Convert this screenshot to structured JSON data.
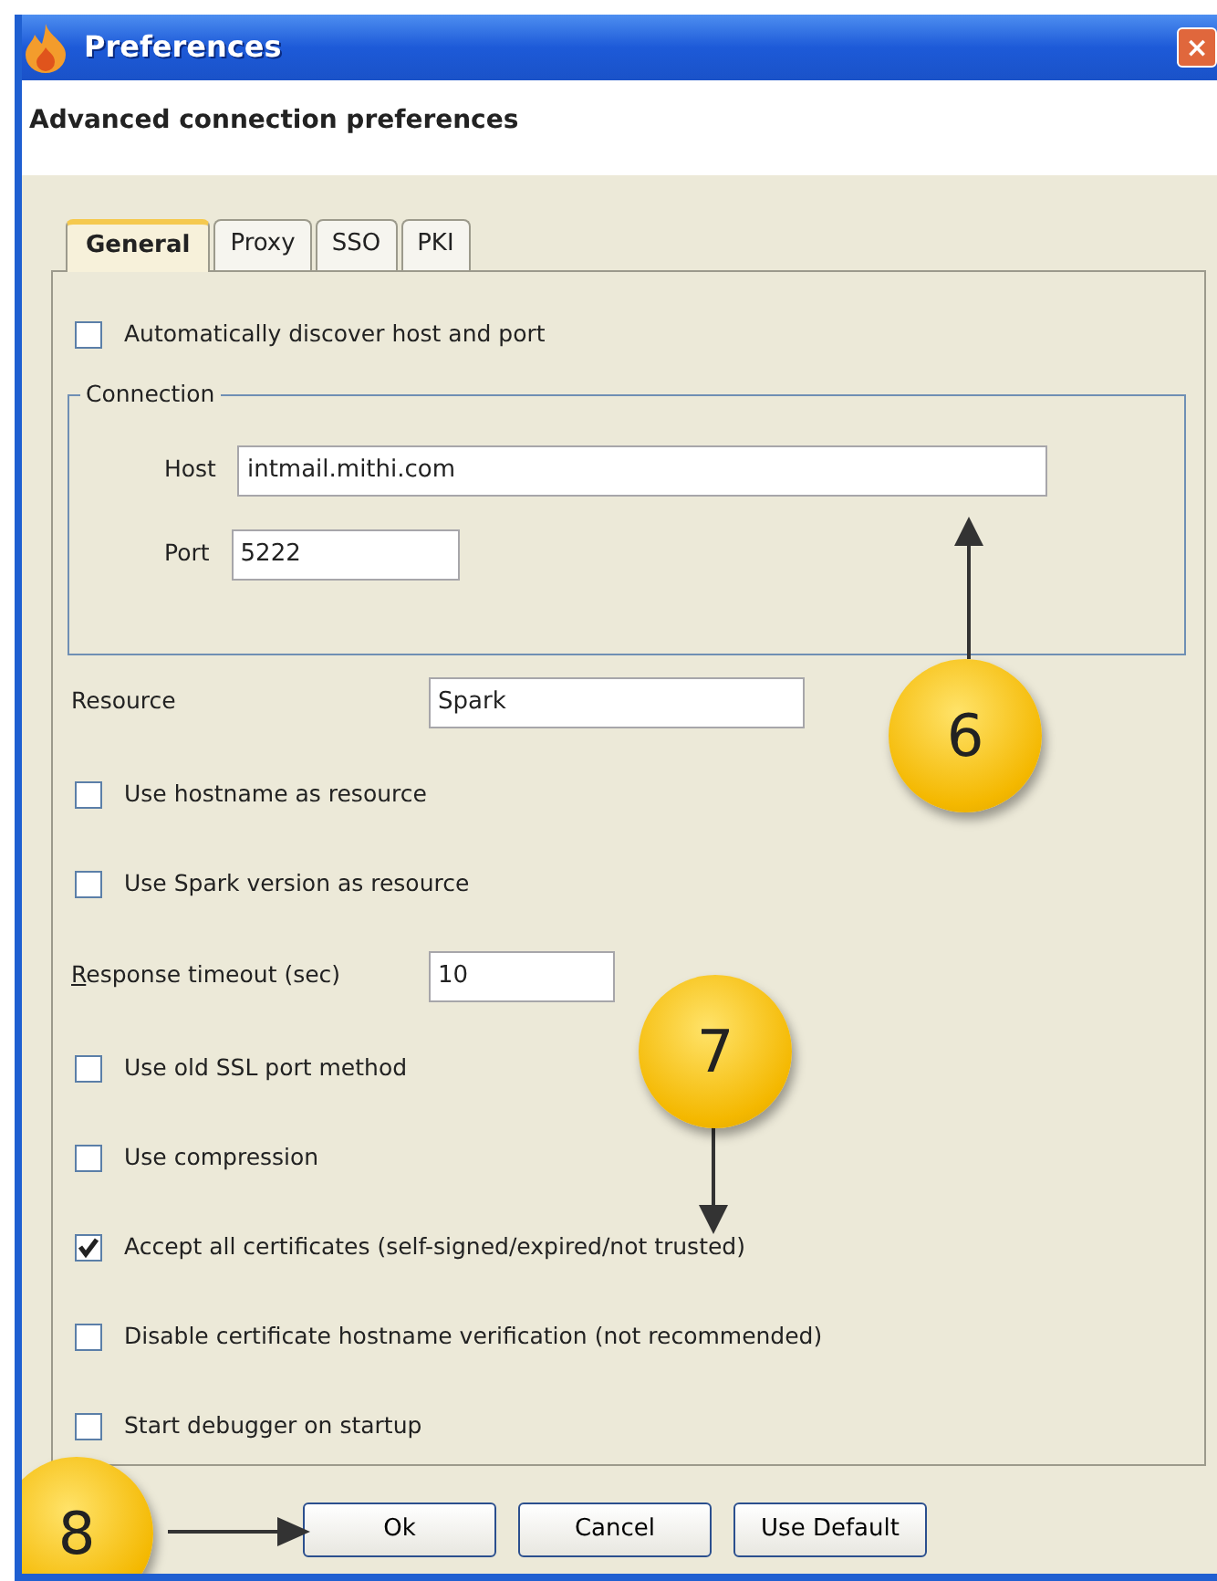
{
  "window": {
    "title": "Preferences",
    "close": "×"
  },
  "header": "Advanced connection preferences",
  "tabs": [
    {
      "label": "General",
      "selected": true
    },
    {
      "label": "Proxy",
      "selected": false
    },
    {
      "label": "SSO",
      "selected": false
    },
    {
      "label": "PKI",
      "selected": false
    }
  ],
  "items": [
    {
      "kind": "checkbox",
      "label": "Automatically discover host and port",
      "checked": false
    },
    {
      "kind": "group",
      "title": "Connection",
      "fields": [
        {
          "label": "Host",
          "value": "intmail.mithi.com"
        },
        {
          "label": "Port",
          "value": "5222"
        }
      ]
    },
    {
      "kind": "field",
      "label": "Resource",
      "value": "Spark",
      "underline_first": false
    },
    {
      "kind": "checkbox",
      "label": "Use hostname as resource",
      "checked": false
    },
    {
      "kind": "checkbox",
      "label": "Use Spark version as resource",
      "checked": false
    },
    {
      "kind": "field",
      "label": "Response timeout (sec)",
      "value": "10",
      "underline_first": true
    },
    {
      "kind": "checkbox",
      "label": "Use old SSL port method",
      "checked": false
    },
    {
      "kind": "checkbox",
      "label": "Use compression",
      "checked": false
    },
    {
      "kind": "checkbox",
      "label": "Accept all certificates (self-signed/expired/not trusted)",
      "checked": true
    },
    {
      "kind": "checkbox",
      "label": "Disable certificate hostname verification (not recommended)",
      "checked": false
    },
    {
      "kind": "checkbox",
      "label": "Start debugger on startup",
      "checked": false
    }
  ],
  "buttons": [
    "Ok",
    "Cancel",
    "Use Default"
  ],
  "callouts": [
    {
      "label": "6"
    },
    {
      "label": "7"
    },
    {
      "label": "8"
    }
  ]
}
